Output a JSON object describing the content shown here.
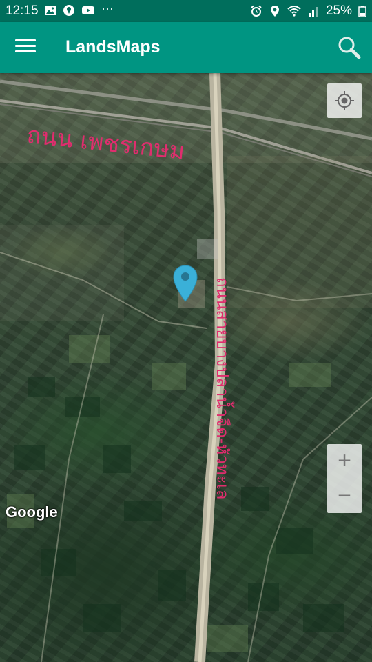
{
  "status_bar": {
    "time": "12:15",
    "more": "···",
    "battery": "25%",
    "left_icons": [
      "image-icon",
      "maps-icon",
      "youtube-icon",
      "more-icon"
    ],
    "right_icons": [
      "alarm-icon",
      "location-icon",
      "wifi-icon",
      "signal-icon",
      "battery-icon"
    ]
  },
  "app_bar": {
    "title": "LandsMaps",
    "menu_icon": "menu-icon",
    "search_icon": "search-icon",
    "color": "#009582",
    "status_color": "#006e5c"
  },
  "map": {
    "road_label_horizontal": "ถนน เพชรเกษม",
    "road_label_vertical": "ถนนสายบางปลาน้ำจืด-หัวทะเล",
    "zoom_in": "+",
    "zoom_out": "−",
    "attribution": "Google",
    "pin_color": "#3ab0d8",
    "label_color": "#e02d6e"
  }
}
